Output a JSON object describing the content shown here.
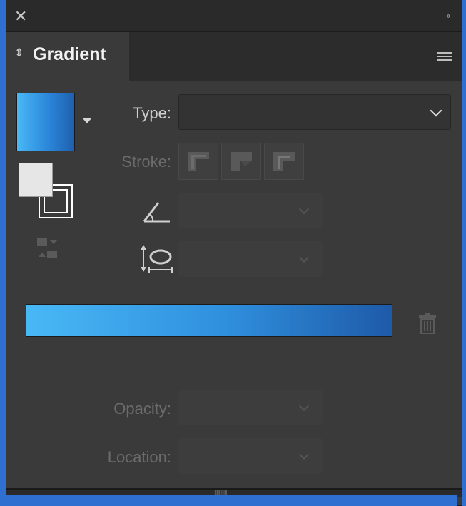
{
  "panel": {
    "close_glyph": "✕",
    "collapse_glyph": "‹‹",
    "tab_arrows_glyph": "⇕",
    "title": "Gradient"
  },
  "gradient": {
    "type_label": "Type:",
    "type_value": "",
    "stroke_label": "Stroke:",
    "angle_value": "",
    "aspect_value": "",
    "opacity_label": "Opacity:",
    "opacity_value": "",
    "location_label": "Location:",
    "location_value": "",
    "start_color": "#49b8f6",
    "end_color": "#1e5aa8"
  },
  "icons": {
    "close": "close-icon",
    "panel_menu": "menu-icon",
    "angle": "angle-icon",
    "aspect_ratio": "aspect-ratio-icon",
    "reverse": "reverse-gradient-icon",
    "delete_stop": "trash-icon"
  }
}
